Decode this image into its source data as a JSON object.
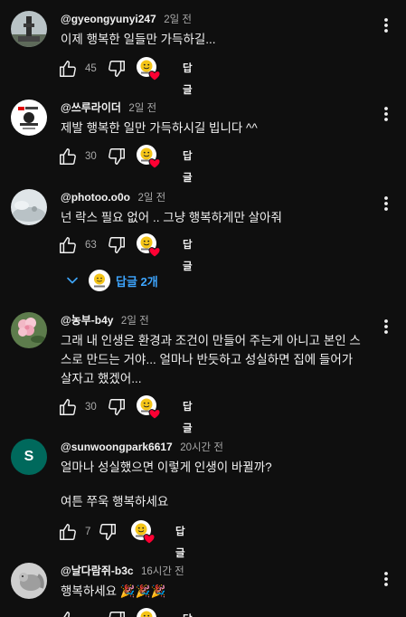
{
  "comments": [
    {
      "author": "@gyeongyunyi247",
      "time": "2일 전",
      "text": [
        "이제 행복한 일들만 가득하길..."
      ],
      "likes": "45",
      "reply_label": "답글",
      "avatar": "city-tower-avatar"
    },
    {
      "author": "@쓰루라이더",
      "time": "2일 전",
      "text": [
        "제발 행복한 일만 가득하시길 빕니다 ^^"
      ],
      "likes": "30",
      "reply_label": "답글",
      "avatar": "rider-logo-avatar"
    },
    {
      "author": "@photoo.o0o",
      "time": "2일 전",
      "text": [
        "넌 락스 필요 없어 .. 그냥 행복하게만 살아줘"
      ],
      "likes": "63",
      "reply_label": "답글",
      "avatar": "misty-photo-avatar",
      "replies_label": "답글 2개"
    },
    {
      "author": "@농부-b4y",
      "time": "2일 전",
      "text": [
        "그래 내 인생은 환경과 조건이 만들어 주는게 아니고 본인 스",
        "스로 만드는 거야... 얼마나 반듯하고 성실하면 집에 들어가",
        "살자고 했겠어..."
      ],
      "likes": "30",
      "reply_label": "답글",
      "avatar": "flower-avatar"
    },
    {
      "author": "@sunwoongpark6617",
      "time": "20시간 전",
      "text": [
        "얼마나 성실했으면 이렇게 인생이 바뀔까?",
        "",
        "여튼 쭈욱 행복하세요"
      ],
      "likes": "7",
      "reply_label": "답글",
      "avatar_letter": "S"
    },
    {
      "author": "@날다람쥐-b3c",
      "time": "16시간 전",
      "text": [
        "행복하세요 🎉🎉🎉"
      ],
      "likes": "",
      "reply_label": "답글",
      "avatar": "squirrel-photo-avatar"
    }
  ],
  "colors": {
    "background": "#0f0f0f",
    "text": "#f1f1f1",
    "secondary": "#aaaaaa",
    "link": "#3ea6ff",
    "heart": "#ff0033",
    "s_avatar": "#00695c"
  }
}
